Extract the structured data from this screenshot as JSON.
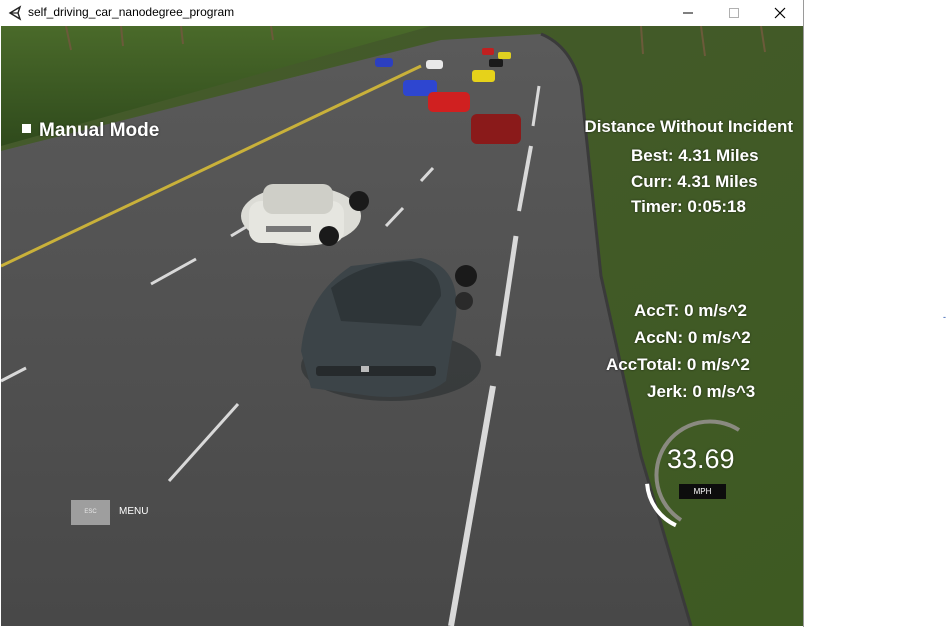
{
  "window": {
    "title": "self_driving_car_nanodegree_program",
    "controls": [
      "minimize",
      "maximize",
      "close"
    ]
  },
  "hud": {
    "mode_label": "Manual Mode",
    "distance_title": "Distance Without Incident",
    "best": "Best: 4.31 Miles",
    "curr": "Curr: 4.31 Miles",
    "timer": "Timer: 0:05:18",
    "acc_t": "AccT: 0 m/s^2",
    "acc_n": "AccN: 0 m/s^2",
    "acc_total": "AccTotal: 0 m/s^2",
    "jerk": "Jerk: 0 m/s^3",
    "esc_label": "ESC",
    "menu_label": "MENU"
  },
  "speedometer": {
    "value": "33.69",
    "unit": "MPH",
    "max_mph": 50
  },
  "colors": {
    "road": "#4a4a4a",
    "grass": "#3c5a22",
    "lane_marking": "#d9d9d9",
    "center_line": "#c9b13a"
  },
  "scene": {
    "cars": [
      {
        "name": "ego-car",
        "color": "dark-gray"
      },
      {
        "name": "white-car",
        "color": "white"
      },
      {
        "name": "red-car",
        "color": "dark-red"
      },
      {
        "name": "red-car-2",
        "color": "red"
      },
      {
        "name": "blue-car",
        "color": "blue"
      },
      {
        "name": "yellow-car",
        "color": "yellow"
      }
    ]
  },
  "edge_mark": "-"
}
